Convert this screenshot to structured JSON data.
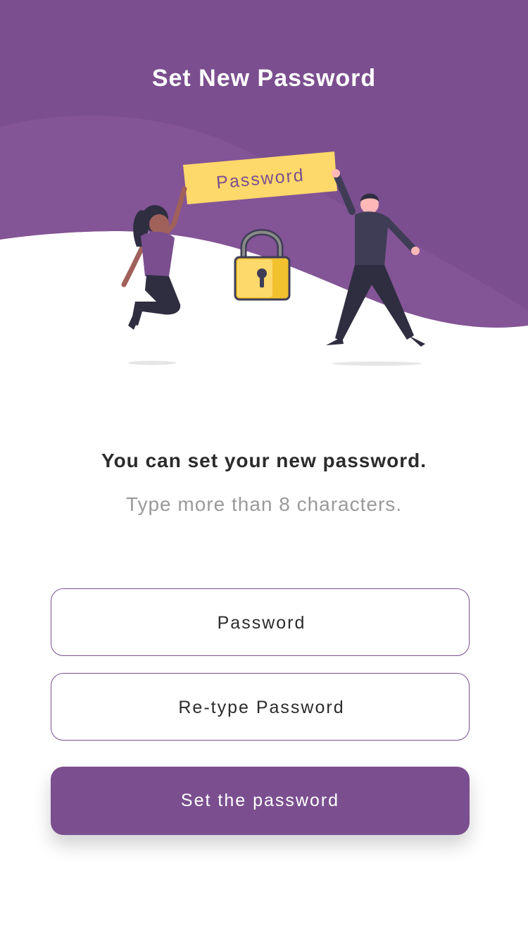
{
  "header": {
    "title": "Set New Password"
  },
  "illustration": {
    "sign_text": "Password"
  },
  "content": {
    "headline": "You can set your new password.",
    "hint": "Type more than 8 characters."
  },
  "form": {
    "password_placeholder": "Password",
    "retype_placeholder": "Re-type Password",
    "submit_label": "Set the password"
  },
  "colors": {
    "brand": "#7b4f8f",
    "brand_dark": "#7a4d8e",
    "accent_yellow": "#ffd166"
  }
}
